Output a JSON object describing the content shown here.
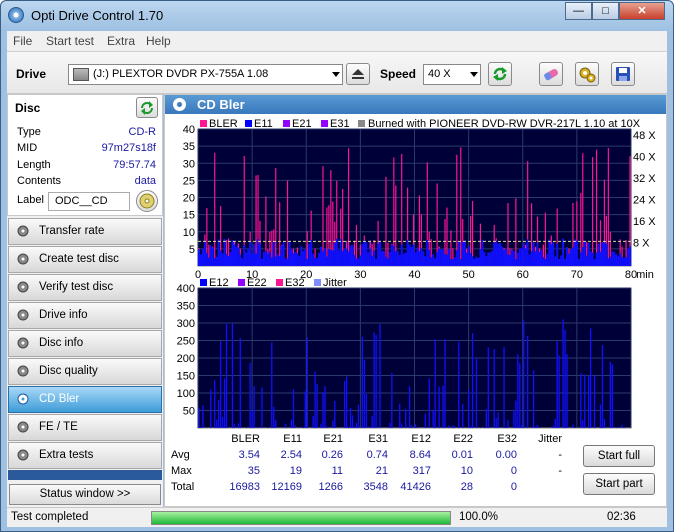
{
  "window": {
    "title": "Opti Drive Control 1.70",
    "btn_min": "—",
    "btn_max": "□",
    "btn_close": "✕"
  },
  "menu": [
    "File",
    "Start test",
    "Extra",
    "Help"
  ],
  "toolbar": {
    "drive_label": "Drive",
    "drive_value": "(J:)   PLEXTOR DVDR   PX-755A 1.08",
    "speed_label": "Speed",
    "speed_value": "40 X"
  },
  "disc": {
    "title": "Disc",
    "type_label": "Type",
    "type_value": "CD-R",
    "mid_label": "MID",
    "mid_value": "97m27s18f",
    "length_label": "Length",
    "length_value": "79:57.74",
    "contents_label": "Contents",
    "contents_value": "data",
    "label_label": "Label",
    "label_value": "ODC__CD"
  },
  "nav": [
    "Transfer rate",
    "Create test disc",
    "Verify test disc",
    "Drive info",
    "Disc info",
    "Disc quality",
    "CD Bler",
    "FE / TE",
    "Extra tests"
  ],
  "nav_active": "CD Bler",
  "status_window_btn": "Status window >>",
  "panel_title": "CD Bler",
  "chart_data": [
    {
      "type": "bar",
      "legend": [
        "BLER",
        "E11",
        "E21",
        "E31"
      ],
      "legend_colors": [
        "#ff1493",
        "#0000ff",
        "#9400ff",
        "#9400ff"
      ],
      "annotation": "Burned with PIONEER DVD-RW  DVR-217L 1.10 at 10X",
      "x_ticks": [
        "0",
        "10",
        "20",
        "30",
        "40",
        "50",
        "60",
        "70",
        "80"
      ],
      "x_unit": "min",
      "xlim": [
        0,
        80
      ],
      "ylim": [
        0,
        40
      ],
      "y_ticks": [
        "5",
        "10",
        "15",
        "20",
        "25",
        "30",
        "35",
        "40"
      ],
      "y2_ticks": [
        "8 X",
        "16 X",
        "24 X",
        "32 X",
        "40 X",
        "48 X"
      ],
      "speed_line_y": 7.2,
      "grid": true
    },
    {
      "type": "bar",
      "legend": [
        "E12",
        "E22",
        "E32",
        "Jitter"
      ],
      "legend_colors": [
        "#0000ff",
        "#9400ff",
        "#ff1493",
        "#7f8cff"
      ],
      "x_ticks": [
        "0",
        "10",
        "20",
        "30",
        "40",
        "50",
        "60",
        "70",
        "80"
      ],
      "x_unit": "min",
      "xlim": [
        0,
        80
      ],
      "ylim": [
        0,
        400
      ],
      "y_ticks": [
        "50",
        "100",
        "150",
        "200",
        "250",
        "300",
        "350",
        "400"
      ],
      "grid": true
    }
  ],
  "stats": {
    "headers": [
      "BLER",
      "E11",
      "E21",
      "E31",
      "E12",
      "E22",
      "E32",
      "Jitter"
    ],
    "rows": [
      {
        "label": "Avg",
        "values": [
          "3.54",
          "2.54",
          "0.26",
          "0.74",
          "8.64",
          "0.01",
          "0.00",
          "-"
        ]
      },
      {
        "label": "Max",
        "values": [
          "35",
          "19",
          "11",
          "21",
          "317",
          "10",
          "0",
          "-"
        ]
      },
      {
        "label": "Total",
        "values": [
          "16983",
          "12169",
          "1266",
          "3548",
          "41426",
          "28",
          "0",
          ""
        ]
      }
    ]
  },
  "buttons": {
    "start_full": "Start full",
    "start_part": "Start part"
  },
  "status": {
    "text": "Test completed",
    "progress_text": "100.0%",
    "progress": 1.0,
    "time": "02:36"
  }
}
